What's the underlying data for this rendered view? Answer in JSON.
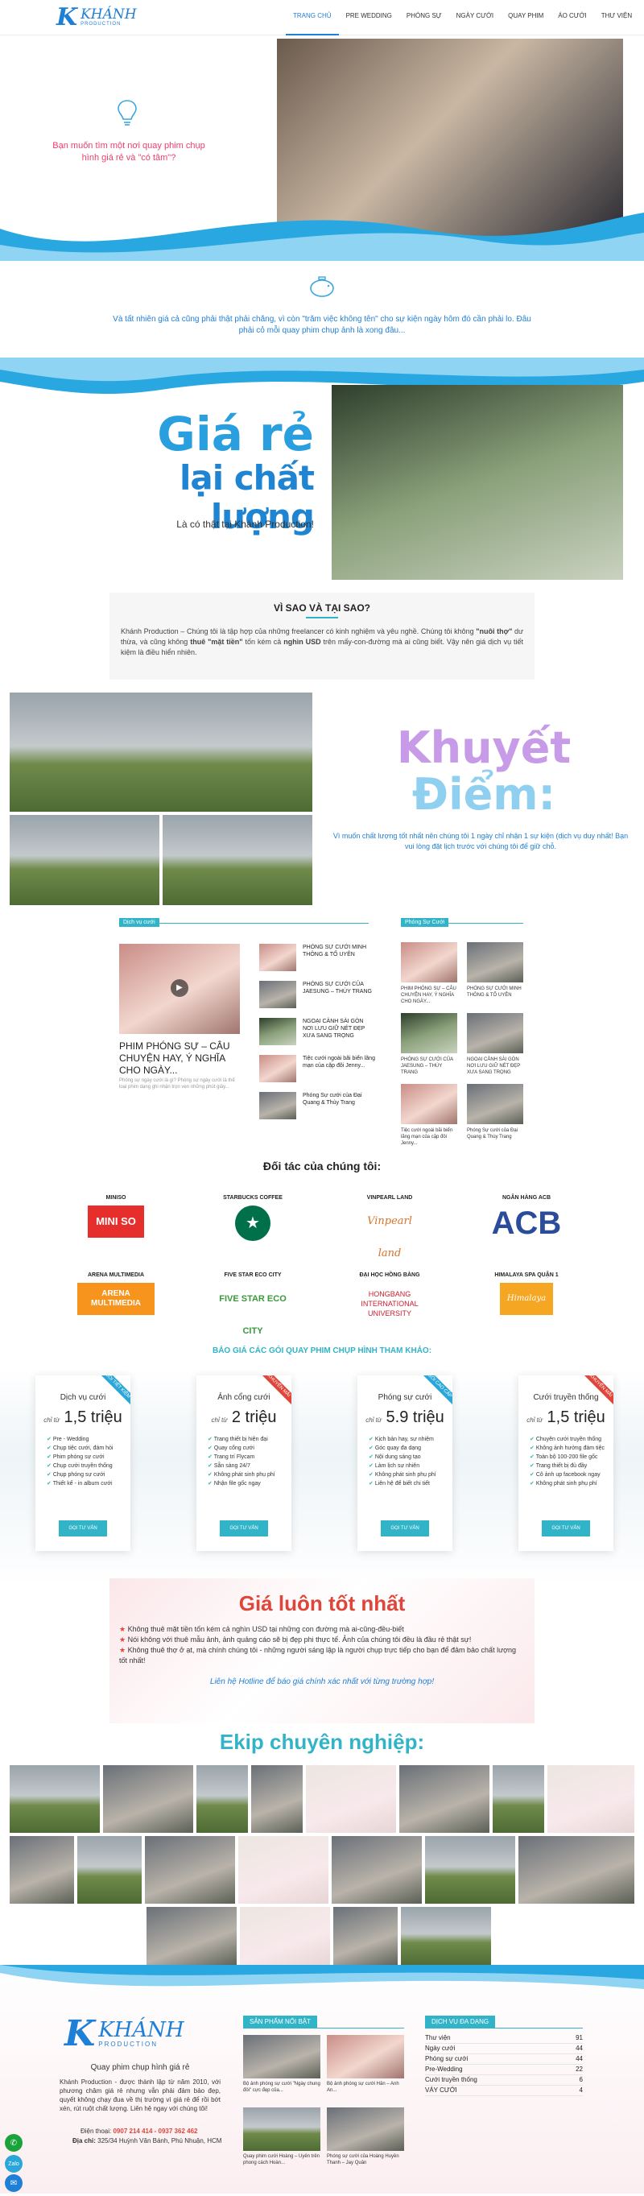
{
  "header": {
    "logo_k": "K",
    "logo_name": "KHÁNH",
    "logo_sub": "PRODUCTION",
    "nav": [
      "TRANG CHỦ",
      "PRE WEDDING",
      "PHÓNG SỰ",
      "NGÀY CƯỚI",
      "QUAY PHIM",
      "ÁO CƯỚI",
      "THƯ VIỆN"
    ]
  },
  "hero": {
    "question": "Bạn muốn tìm một nơi quay phim chụp hình giá rẻ và \"có tâm\"?",
    "icon": "lightbulb-icon"
  },
  "intro2": {
    "icon": "piggy-bank-icon",
    "text": "Và tất nhiên giá cả cũng phải thật phải chăng, vì còn \"trăm việc không tên\" cho sự kiện ngày hôm đó cần phải lo. Đâu phải cỏ mỗi quay phim chụp ảnh là xong đâu..."
  },
  "cheap": {
    "line1": "Giá rẻ",
    "line2": "lại chất lượng",
    "sub": "Là có thật tại Khánh Production!"
  },
  "why": {
    "title": "VÌ SAO VÀ TẠI SAO?",
    "p1": "Khánh Production – Chúng tôi là tập hợp của những freelancer có kinh nghiệm và yêu nghề. Chúng tôi không ",
    "b1": "\"nuôi thợ\"",
    "p2": " dư thừa, và cũng không ",
    "b2": "thuê \"mặt tiền\"",
    "p3": " tốn kém cả ",
    "b3": "nghìn USD",
    "p4": " trên mấy-con-đường mà ai cũng biết. Vậy nên giá dịch vụ tiết kiệm là điều hiển nhiên."
  },
  "weak": {
    "line1": "Khuyết",
    "line2": "Điểm:",
    "text": "Vì muốn chất lượng tốt nhất nên chúng tôi 1 ngày chỉ nhận 1 sự kiện (dịch vụ duy nhất! Bạn vui lòng đặt lịch trước với chúng tôi để giữ chỗ."
  },
  "news": {
    "left_tag": "Dịch vụ cưới",
    "feature_title": "PHIM PHÓNG SỰ – CÂU CHUYỆN HAY, Ý NGHĨA CHO NGÀY...",
    "feature_desc": "Phóng sự ngày cưới là gì? Phóng sự ngày cưới là thể loại phim dạng ghi nhận trọn vẹn những phút giây...",
    "list": [
      "PHÓNG SỰ CƯỚI MINH THÔNG & TỐ UYÊN",
      "PHÓNG SỰ CƯỚI CỦA JAESUNG – THÚY TRANG",
      "NGOẠI CẢNH SÀI GÒN NƠI LƯU GIỮ NÉT ĐẸP XƯA SANG TRỌNG",
      "Tiệc cưới ngoài bãi biển lãng mạn của cặp đôi Jenny...",
      "Phóng Sự cưới của Đại Quang & Thùy Trang"
    ],
    "right_tag": "Phóng Sự Cưới",
    "grid": [
      "PHIM PHÓNG SỰ – CÂU CHUYỆN HAY, Ý NGHĨA CHO NGÀY...",
      "PHÓNG SỰ CƯỚI MINH THÔNG & TỐ UYÊN",
      "PHÓNG SỰ CƯỚI CỦA JAESUNG – THÚY TRANG",
      "NGOẠI CẢNH SÀI GÒN NƠI LƯU GIỮ NÉT ĐẸP XƯA SANG TRỌNG",
      "Tiệc cưới ngoài bãi biển lãng mạn của cặp đôi Jenny...",
      "Phóng Sự cưới của Đại Quang & Thùy Trang"
    ]
  },
  "partners": {
    "title": "Đối tác của chúng tôi:",
    "items": [
      {
        "name": "MINISO",
        "logo": "MINI SO"
      },
      {
        "name": "STARBUCKS COFFEE",
        "logo": "★"
      },
      {
        "name": "VINPEARL LAND",
        "logo": "Vinpearl land"
      },
      {
        "name": "NGÂN HÀNG ACB",
        "logo": "ACB"
      },
      {
        "name": "ARENA MULTIMEDIA",
        "logo": "ARENA MULTIMEDIA"
      },
      {
        "name": "FIVE STAR ECO CITY",
        "logo": "FIVE STAR ECO CITY"
      },
      {
        "name": "ĐẠI HỌC HỒNG BÀNG",
        "logo": "HONGBANG INTERNATIONAL UNIVERSITY"
      },
      {
        "name": "HIMALAYA SPA QUẬN 1",
        "logo": "Himalaya Spa"
      }
    ]
  },
  "pricing": {
    "title": "BẢO GIÁ CÁC GÓI QUAY PHIM CHỤP HÌNH THAM KHẢO:",
    "prefix": "chỉ từ",
    "button": "GỌI TƯ VẤN",
    "plans": [
      {
        "name": "Dịch vụ cưới",
        "price": "1,5 triệu",
        "ribbon": "GÓI TIẾT KIỆM",
        "features": [
          "Pre - Wedding",
          "Chụp tiệc cưới, đám hỏi",
          "Phim phóng sự cưới",
          "Chụp cưới truyền thống",
          "Chụp phóng sự cưới",
          "Thiết kế - in album cưới"
        ]
      },
      {
        "name": "Ảnh cổng cưới",
        "price": "2 triệu",
        "ribbon": "KHUYẾN MÃI",
        "features": [
          "Trang thiết bị hiện đại",
          "Quay cổng cưới",
          "Trang trí Flycam",
          "Sẵn sàng 24/7",
          "Không phát sinh phụ phí",
          "Nhận file gốc ngay"
        ]
      },
      {
        "name": "Phóng sự cưới",
        "price": "5.9 triệu",
        "ribbon": "GÓI CAO CẤP",
        "features": [
          "Kịch bản hay, sự nhiệm",
          "Góc quay đa dạng",
          "Nội dung sáng tạo",
          "Làm lịch sự nhiên",
          "Không phát sinh phụ phí",
          "Liên hệ để biết chi tiết"
        ]
      },
      {
        "name": "Cưới truyền thống",
        "price": "1,5 triệu",
        "ribbon": "KHUYẾN MÃI",
        "features": [
          "Chuyên cưới truyền thống",
          "Không ảnh hưởng đám tiệc",
          "Toàn bộ 100-200 file gốc",
          "Trang thiết bị đủ đầy",
          "Cô ảnh up facebook ngay",
          "Không phát sinh phụ phí"
        ]
      }
    ]
  },
  "best": {
    "title": "Giá luôn tốt nhất",
    "items": [
      "Không thuê mặt tiền tốn kém cả nghìn USD tại những con đường mà ai-cũng-đều-biết",
      "Nói không với thuê mẫu ảnh, ảnh quảng cáo sẽ bị đẹp phi thực tế. Ảnh của chúng tôi đều là đầu rẻ thật sự!",
      "Không thuê thợ ở ạt, mà chính chúng tôi - những người sáng lập là người chụp trực tiếp cho bạn để đảm bảo chất lượng tốt nhất!"
    ],
    "hotline": "Liên hệ Hotline để báo giá chính xác nhất với từng trường hợp!"
  },
  "team": {
    "title": "Ekip chuyên nghiệp:"
  },
  "footer": {
    "slogan": "Quay phim chụp hình giá rẻ",
    "about": "Khánh Production - được thành lập từ năm 2010, với phương châm giá rẻ nhưng vẫn phải đảm bảo đẹp, quyết không chạy đua về thị trường vì giá rẻ để rồi bớt xén, rút ruột chất lượng. Liên hệ ngay với chúng tôi!",
    "phone_label": "Điện thoại:",
    "phone": "0907 214 414 - 0937 362 462",
    "addr_label": "Địa chỉ:",
    "addr": "325/34 Huỳnh Văn Bánh, Phú Nhuận, HCM",
    "featured_title": "SẢN PHẨM NỔI BẬT",
    "featured": [
      "Bộ ảnh phóng sự cưới \"Ngày chung đôi\" cực đẹp của...",
      "Bộ ảnh phóng sự cưới Hân – Anh An...",
      "Quay phim cưới Hoàng – Uyên trên phong cách Hoàn...",
      "Phóng sự cưới của Hoàng Huyền Thanh – Jay Quân"
    ],
    "svc_title": "DỊCH VỤ ĐA DẠNG",
    "services": [
      {
        "name": "Thư viện",
        "count": "91"
      },
      {
        "name": "Ngày cưới",
        "count": "44"
      },
      {
        "name": "Phóng sự cưới",
        "count": "44"
      },
      {
        "name": "Pre-Wedding",
        "count": "22"
      },
      {
        "name": "Cưới truyền thống",
        "count": "6"
      },
      {
        "name": "VÁY CƯỚI",
        "count": "4"
      }
    ]
  },
  "float": {
    "phone_icon": "phone-icon",
    "chat_icon": "chat-icon",
    "zalo": "Zalo"
  },
  "colors": {
    "accent": "#1e7fd6",
    "teal": "#31b4c8",
    "pink": "#ee3e6d",
    "red": "#e0453a"
  }
}
